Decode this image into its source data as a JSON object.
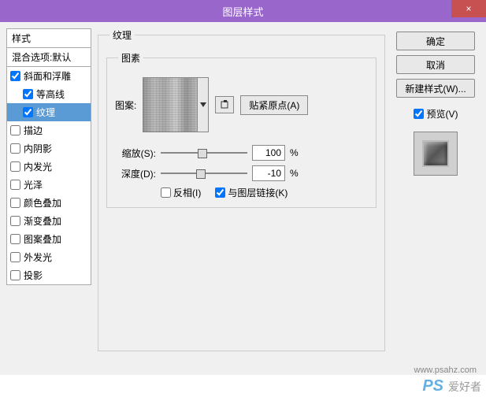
{
  "title": "图层样式",
  "close": "×",
  "styles": {
    "header": "样式",
    "blend": "混合选项:默认",
    "items": [
      {
        "label": "斜面和浮雕",
        "checked": true,
        "child": false,
        "selected": false
      },
      {
        "label": "等高线",
        "checked": true,
        "child": true,
        "selected": false
      },
      {
        "label": "纹理",
        "checked": true,
        "child": true,
        "selected": true
      },
      {
        "label": "描边",
        "checked": false,
        "child": false,
        "selected": false
      },
      {
        "label": "内阴影",
        "checked": false,
        "child": false,
        "selected": false
      },
      {
        "label": "内发光",
        "checked": false,
        "child": false,
        "selected": false
      },
      {
        "label": "光泽",
        "checked": false,
        "child": false,
        "selected": false
      },
      {
        "label": "颜色叠加",
        "checked": false,
        "child": false,
        "selected": false
      },
      {
        "label": "渐变叠加",
        "checked": false,
        "child": false,
        "selected": false
      },
      {
        "label": "图案叠加",
        "checked": false,
        "child": false,
        "selected": false
      },
      {
        "label": "外发光",
        "checked": false,
        "child": false,
        "selected": false
      },
      {
        "label": "投影",
        "checked": false,
        "child": false,
        "selected": false
      }
    ]
  },
  "main": {
    "outer_legend": "纹理",
    "inner_legend": "图素",
    "pattern_label": "图案:",
    "snap_origin": "贴紧原点(A)",
    "scale_label": "缩放(S):",
    "scale_value": "100",
    "depth_label": "深度(D):",
    "depth_value": "-10",
    "percent": "%",
    "invert": "反相(I)",
    "link": "与图层链接(K)",
    "invert_checked": false,
    "link_checked": true
  },
  "right": {
    "ok": "确定",
    "cancel": "取消",
    "new_style": "新建样式(W)...",
    "preview": "预览(V)",
    "preview_checked": true
  },
  "watermark": {
    "url": "www.psahz.com",
    "ps": "PS",
    "cn": "爱好者"
  }
}
